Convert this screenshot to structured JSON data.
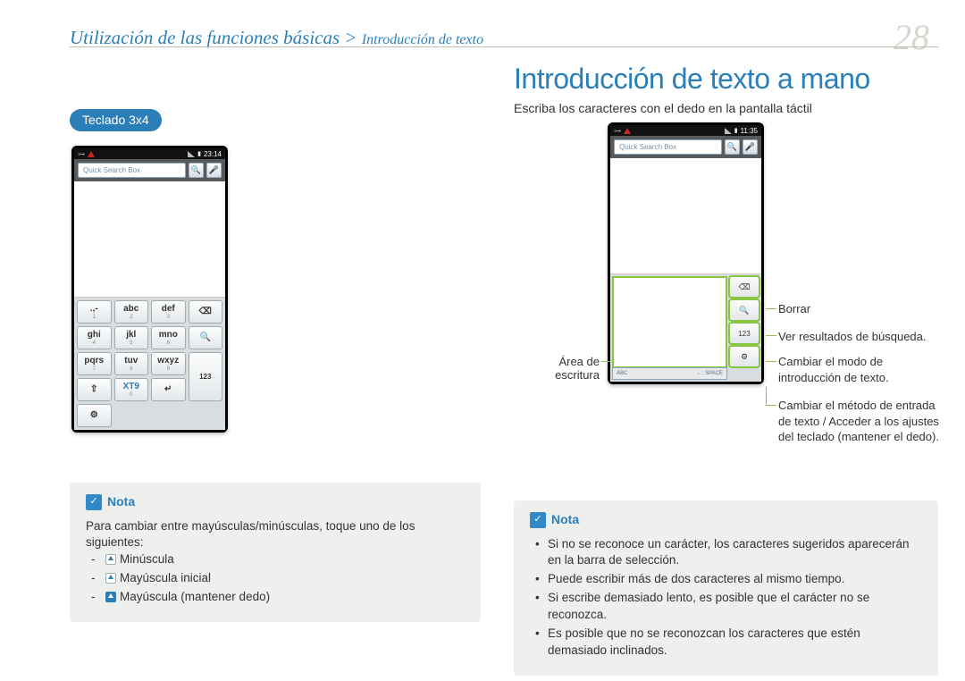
{
  "header": {
    "breadcrumb_main": "Utilización de las funciones básicas > ",
    "breadcrumb_sub": "Introducción de texto",
    "page_number": "28"
  },
  "left": {
    "pill": "Teclado 3x4",
    "phone": {
      "time": "23:14",
      "search_placeholder": "Quick Search Box",
      "keys": {
        "r1": [
          ".,-",
          "abc",
          "def"
        ],
        "r1sub": [
          "1",
          "2",
          "3"
        ],
        "r2": [
          "ghi",
          "jkl",
          "mno"
        ],
        "r2sub": [
          "4",
          "5",
          "6"
        ],
        "r3": [
          "pqrs",
          "tuv",
          "wxyz"
        ],
        "r3sub": [
          "7",
          "8",
          "9"
        ],
        "r4_shift": "⇧",
        "r4_xt9": "XT9",
        "r4_xt9_sub": "0",
        "r4_enter": "↵",
        "side_del": "⌫",
        "side_search": "🔍",
        "side_123": "123",
        "side_gear": "⚙"
      }
    },
    "note": {
      "title": "Nota",
      "intro": "Para cambiar entre mayúsculas/minúsculas, toque uno de los siguientes:",
      "items": [
        "Minúscula",
        "Mayúscula inicial",
        "Mayúscula (mantener dedo)"
      ]
    }
  },
  "right": {
    "title": "Introducción de texto a mano",
    "lead": "Escriba los caracteres con el dedo en la pantalla táctil",
    "phone": {
      "time": "11:35",
      "search_placeholder": "Quick Search Box",
      "strip_left": "ABC",
      "strip_right": "←: SPACE",
      "side_del": "⌫",
      "side_search": "🔍",
      "side_123": "123",
      "side_gear": "⚙"
    },
    "callouts": {
      "area": "Área de escritura",
      "del": "Borrar",
      "search": "Ver resultados de búsqueda.",
      "mode": "Cambiar el modo de introducción de texto.",
      "gear": "Cambiar el método de entrada de texto / Acceder a los ajustes del teclado (mantener el dedo)."
    },
    "note": {
      "title": "Nota",
      "items": [
        "Si no se reconoce un carácter, los caracteres sugeridos aparecerán en la barra de selección.",
        "Puede escribir más de dos caracteres al mismo tiempo.",
        "Si escribe demasiado lento, es posible que el carácter no se reconozca.",
        "Es posible que no se reconozcan los caracteres que estén demasiado inclinados."
      ]
    }
  }
}
